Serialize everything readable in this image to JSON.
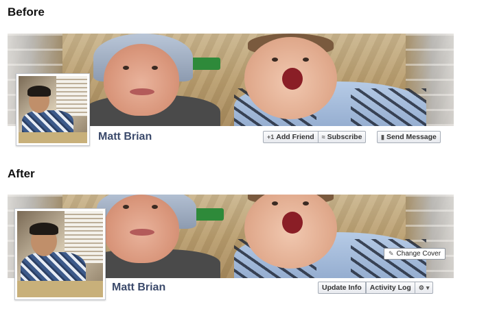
{
  "sections": {
    "before": {
      "heading": "Before",
      "name": "Matt Brian",
      "buttons": {
        "add_friend": "Add Friend",
        "subscribe": "Subscribe",
        "send_message": "Send Message"
      },
      "icons": {
        "add_friend": "add-friend-icon",
        "subscribe": "rss-icon",
        "send_message": "message-icon"
      }
    },
    "after": {
      "heading": "After",
      "name": "Matt Brian",
      "change_cover": "Change Cover",
      "buttons": {
        "update_info": "Update Info",
        "activity_log": "Activity Log"
      },
      "icons": {
        "change_cover": "pencil-icon",
        "settings": "gear-icon",
        "settings_caret": "caret-down-icon"
      }
    }
  },
  "colors": {
    "name_text": "#3b4a6b",
    "button_border": "#a5acb6"
  }
}
